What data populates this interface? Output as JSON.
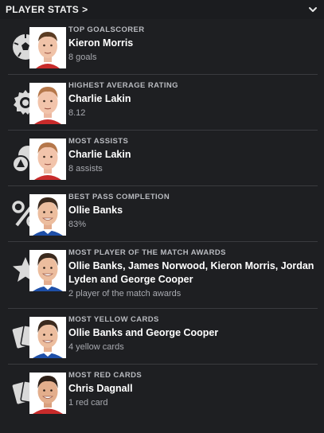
{
  "header": {
    "title": "PLAYER STATS",
    "title_chevron": ">"
  },
  "stats": [
    {
      "label": "TOP GOALSCORER",
      "name": "Kieron Morris",
      "value": "8 goals",
      "icon": "football-icon",
      "face": "kieron-morris"
    },
    {
      "label": "HIGHEST AVERAGE RATING",
      "name": "Charlie Lakin",
      "value": "8.12",
      "icon": "rosette-icon",
      "face": "charlie-lakin"
    },
    {
      "label": "MOST ASSISTS",
      "name": "Charlie Lakin",
      "value": "8 assists",
      "icon": "assist-icon",
      "face": "charlie-lakin"
    },
    {
      "label": "BEST PASS COMPLETION",
      "name": "Ollie Banks",
      "value": "83%",
      "icon": "percent-icon",
      "face": "ollie-banks"
    },
    {
      "label": "MOST PLAYER OF THE MATCH AWARDS",
      "name": "Ollie Banks, James Norwood, Kieron Morris, Jordan Lyden and George Cooper",
      "value": "2 player of the match awards",
      "icon": "star-icon",
      "face": "ollie-banks"
    },
    {
      "label": "MOST YELLOW CARDS",
      "name": "Ollie Banks and George Cooper",
      "value": "4 yellow cards",
      "icon": "yellow-card-icon",
      "face": "ollie-banks"
    },
    {
      "label": "MOST RED CARDS",
      "name": "Chris Dagnall",
      "value": "1 red card",
      "icon": "red-card-icon",
      "face": "chris-dagnall"
    }
  ],
  "colors": {
    "background": "#1e1f22",
    "divider": "#3a3b3f",
    "label": "#b9bbc0",
    "value": "#a8aab0",
    "icon": "#d9d9d9"
  }
}
